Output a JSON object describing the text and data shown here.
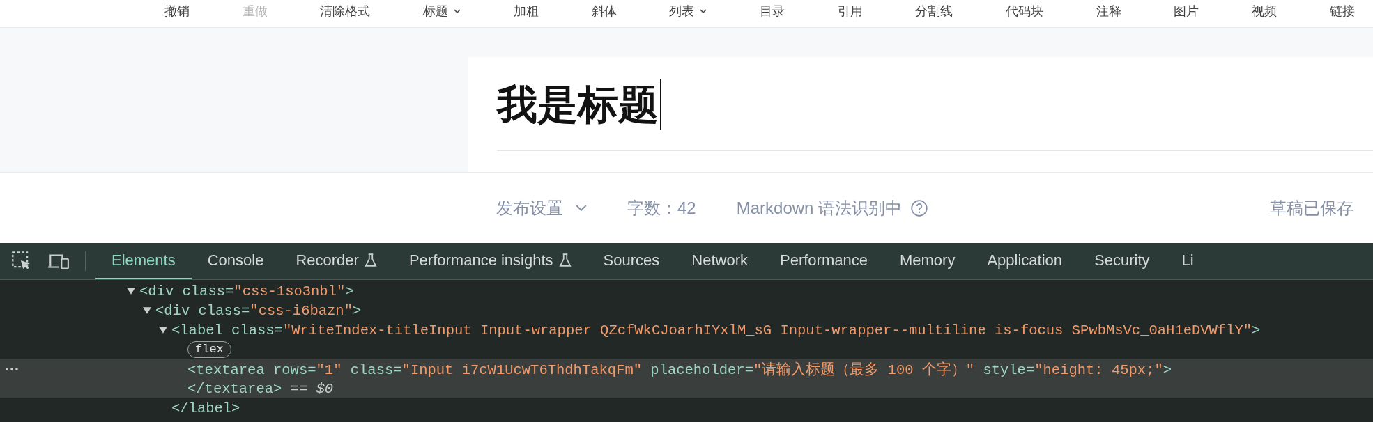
{
  "toolbar": {
    "items": [
      {
        "label": "撤销",
        "disabled": false,
        "dropdown": false
      },
      {
        "label": "重做",
        "disabled": true,
        "dropdown": false
      },
      {
        "label": "清除格式",
        "disabled": false,
        "dropdown": false
      },
      {
        "label": "标题",
        "disabled": false,
        "dropdown": true
      },
      {
        "label": "加粗",
        "disabled": false,
        "dropdown": false
      },
      {
        "label": "斜体",
        "disabled": false,
        "dropdown": false
      },
      {
        "label": "列表",
        "disabled": false,
        "dropdown": true
      },
      {
        "label": "目录",
        "disabled": false,
        "dropdown": false
      },
      {
        "label": "引用",
        "disabled": false,
        "dropdown": false
      },
      {
        "label": "分割线",
        "disabled": false,
        "dropdown": false
      },
      {
        "label": "代码块",
        "disabled": false,
        "dropdown": false
      },
      {
        "label": "注释",
        "disabled": false,
        "dropdown": false
      },
      {
        "label": "图片",
        "disabled": false,
        "dropdown": false
      },
      {
        "label": "视频",
        "disabled": false,
        "dropdown": false
      },
      {
        "label": "链接",
        "disabled": false,
        "dropdown": false
      }
    ]
  },
  "editor": {
    "title": "我是标题",
    "focused": true
  },
  "footer": {
    "publish_settings": "发布设置",
    "word_count": "字数：42",
    "markdown_status": "Markdown 语法识别中",
    "save_status": "草稿已保存"
  },
  "devtools": {
    "tabs": [
      {
        "label": "Elements",
        "selected": true,
        "experimental": false
      },
      {
        "label": "Console",
        "selected": false,
        "experimental": false
      },
      {
        "label": "Recorder",
        "selected": false,
        "experimental": true
      },
      {
        "label": "Performance insights",
        "selected": false,
        "experimental": true
      },
      {
        "label": "Sources",
        "selected": false,
        "experimental": false
      },
      {
        "label": "Network",
        "selected": false,
        "experimental": false
      },
      {
        "label": "Performance",
        "selected": false,
        "experimental": false
      },
      {
        "label": "Memory",
        "selected": false,
        "experimental": false
      },
      {
        "label": "Application",
        "selected": false,
        "experimental": false
      },
      {
        "label": "Security",
        "selected": false,
        "experimental": false
      },
      {
        "label": "Li",
        "selected": false,
        "experimental": false
      }
    ],
    "dom_tree": [
      {
        "expanded": true,
        "selected": false,
        "open": [
          {
            "kind": "tag",
            "text": "<div"
          },
          {
            "kind": "attr",
            "text": " class"
          },
          {
            "kind": "tag",
            "text": "="
          },
          {
            "kind": "value",
            "text": "\"css-1so3nbl\""
          },
          {
            "kind": "tag",
            "text": ">"
          }
        ],
        "children": [
          {
            "expanded": true,
            "selected": false,
            "open": [
              {
                "kind": "tag",
                "text": "<div"
              },
              {
                "kind": "attr",
                "text": " class"
              },
              {
                "kind": "tag",
                "text": "="
              },
              {
                "kind": "value",
                "text": "\"css-i6bazn\""
              },
              {
                "kind": "tag",
                "text": ">"
              }
            ],
            "children": [
              {
                "expanded": true,
                "selected": false,
                "badge": "flex",
                "open": [
                  {
                    "kind": "tag",
                    "text": "<label"
                  },
                  {
                    "kind": "attr",
                    "text": " class"
                  },
                  {
                    "kind": "tag",
                    "text": "="
                  },
                  {
                    "kind": "value",
                    "text": "\"WriteIndex-titleInput Input-wrapper QZcfWkCJoarhIYxlM_sG Input-wrapper--multiline is-focus SPwbMsVc_0aH1eDVWflY\""
                  },
                  {
                    "kind": "tag",
                    "text": ">"
                  }
                ],
                "children": [
                  {
                    "selected": true,
                    "open": [
                      {
                        "kind": "tag",
                        "text": "<textarea"
                      },
                      {
                        "kind": "attr",
                        "text": " rows"
                      },
                      {
                        "kind": "tag",
                        "text": "="
                      },
                      {
                        "kind": "value",
                        "text": "\"1\""
                      },
                      {
                        "kind": "attr",
                        "text": " class"
                      },
                      {
                        "kind": "tag",
                        "text": "="
                      },
                      {
                        "kind": "value",
                        "text": "\"Input i7cW1UcwT6ThdhTakqFm\""
                      },
                      {
                        "kind": "attr",
                        "text": " placeholder"
                      },
                      {
                        "kind": "tag",
                        "text": "="
                      },
                      {
                        "kind": "value",
                        "text": "\"请输入标题（最多 100 个字）\""
                      },
                      {
                        "kind": "attr",
                        "text": " style"
                      },
                      {
                        "kind": "tag",
                        "text": "="
                      },
                      {
                        "kind": "value",
                        "text": "\"height: 45px;\""
                      },
                      {
                        "kind": "tag",
                        "text": ">"
                      }
                    ],
                    "close": [
                      {
                        "kind": "tag",
                        "text": "</textarea>"
                      },
                      {
                        "kind": "note",
                        "text": " == "
                      },
                      {
                        "kind": "ref",
                        "text": "$0"
                      }
                    ]
                  }
                ],
                "close": [
                  {
                    "kind": "tag",
                    "text": "</label>"
                  }
                ]
              }
            ]
          }
        ]
      }
    ]
  }
}
